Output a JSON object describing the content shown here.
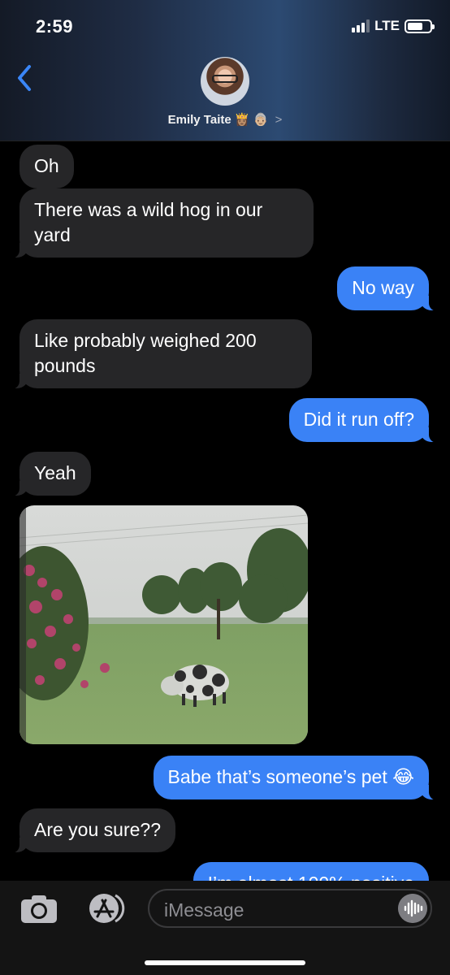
{
  "status": {
    "time": "2:59",
    "network": "LTE",
    "battery": 0.7
  },
  "header": {
    "contact_name": "Emily Taite",
    "contact_emojis": "👸🏽 👵🏼",
    "chevron": ">"
  },
  "messages": [
    {
      "from": "them",
      "text": "Oh"
    },
    {
      "from": "them",
      "text": "There was a wild hog in our yard"
    },
    {
      "from": "me",
      "text": "No way"
    },
    {
      "from": "them",
      "text": "Like probably weighed 200 pounds"
    },
    {
      "from": "me",
      "text": "Did it run off?"
    },
    {
      "from": "them",
      "text": "Yeah"
    },
    {
      "from": "them",
      "type": "photo",
      "icon": "spotted-pig-in-field-photo"
    },
    {
      "from": "me",
      "text": "Babe that’s someone’s pet 😂"
    },
    {
      "from": "them",
      "text": "Are you sure??"
    },
    {
      "from": "me",
      "text": "I’m almost 100% positive"
    }
  ],
  "composer": {
    "placeholder": "iMessage"
  },
  "colors": {
    "outgoing": "#3a82f6",
    "incoming": "#262628",
    "background": "#000000"
  }
}
